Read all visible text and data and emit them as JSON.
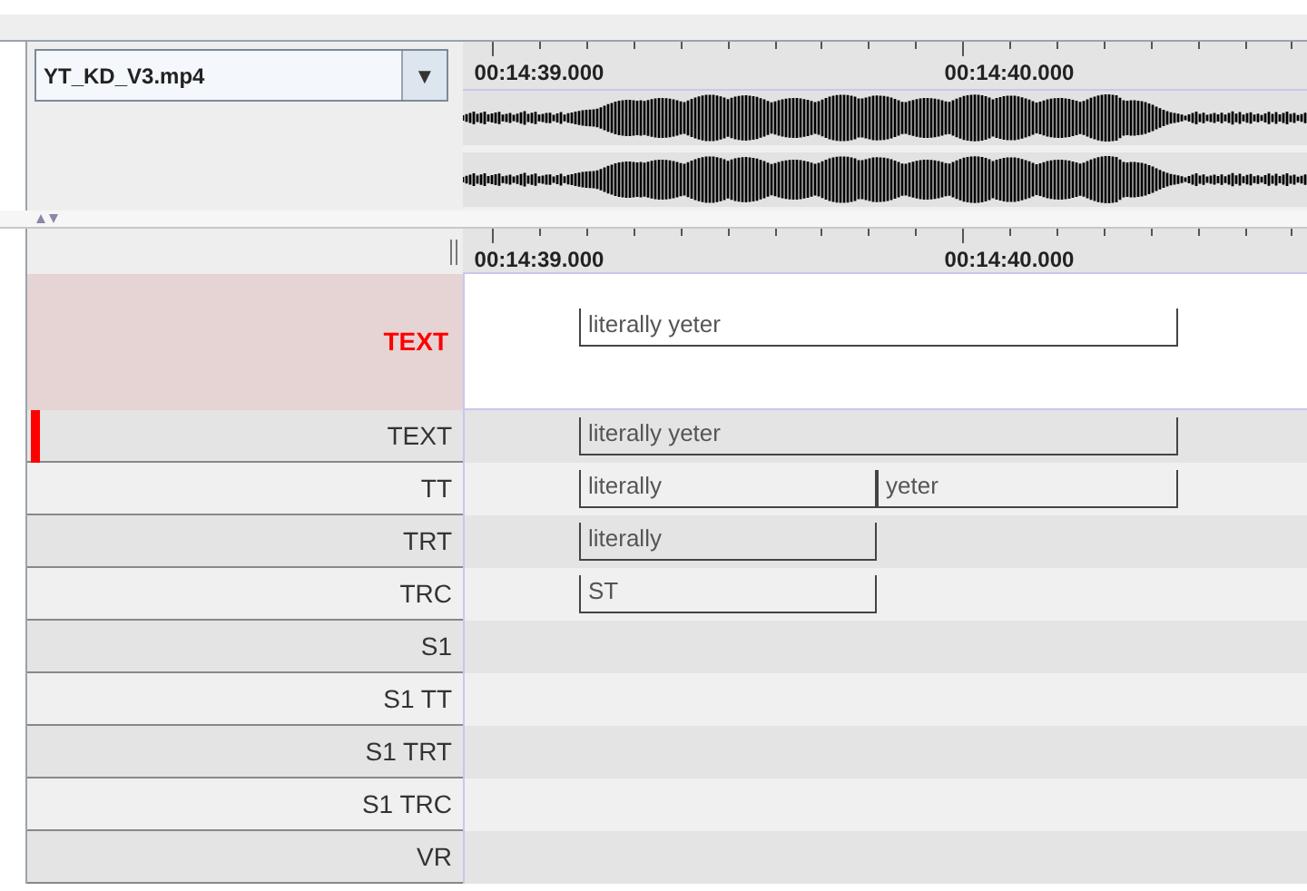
{
  "media_selector": {
    "value": "YT_KD_V3.mp4",
    "arrow": "▼"
  },
  "waveform_ruler": {
    "labels": [
      "00:14:39.000",
      "00:14:40.000"
    ]
  },
  "timeline_ruler": {
    "labels": [
      "00:14:39.000",
      "00:14:40.000"
    ]
  },
  "active_tier": {
    "label": "TEXT",
    "annotations": [
      {
        "text": "literally yeter",
        "kind": "whole"
      }
    ]
  },
  "tiers": [
    {
      "label": "TEXT",
      "selected": true,
      "annotations": [
        {
          "text": "literally yeter",
          "kind": "whole"
        }
      ]
    },
    {
      "label": "TT",
      "selected": false,
      "annotations": [
        {
          "text": "literally",
          "kind": "first"
        },
        {
          "text": "yeter",
          "kind": "second"
        }
      ]
    },
    {
      "label": "TRT",
      "selected": false,
      "annotations": [
        {
          "text": "literally",
          "kind": "first"
        }
      ]
    },
    {
      "label": "TRC",
      "selected": false,
      "annotations": [
        {
          "text": "ST",
          "kind": "first"
        }
      ]
    },
    {
      "label": "S1",
      "selected": false
    },
    {
      "label": "S1 TT",
      "selected": false
    },
    {
      "label": "S1 TRT",
      "selected": false
    },
    {
      "label": "S1 TRC",
      "selected": false
    },
    {
      "label": "VR",
      "selected": false
    }
  ]
}
